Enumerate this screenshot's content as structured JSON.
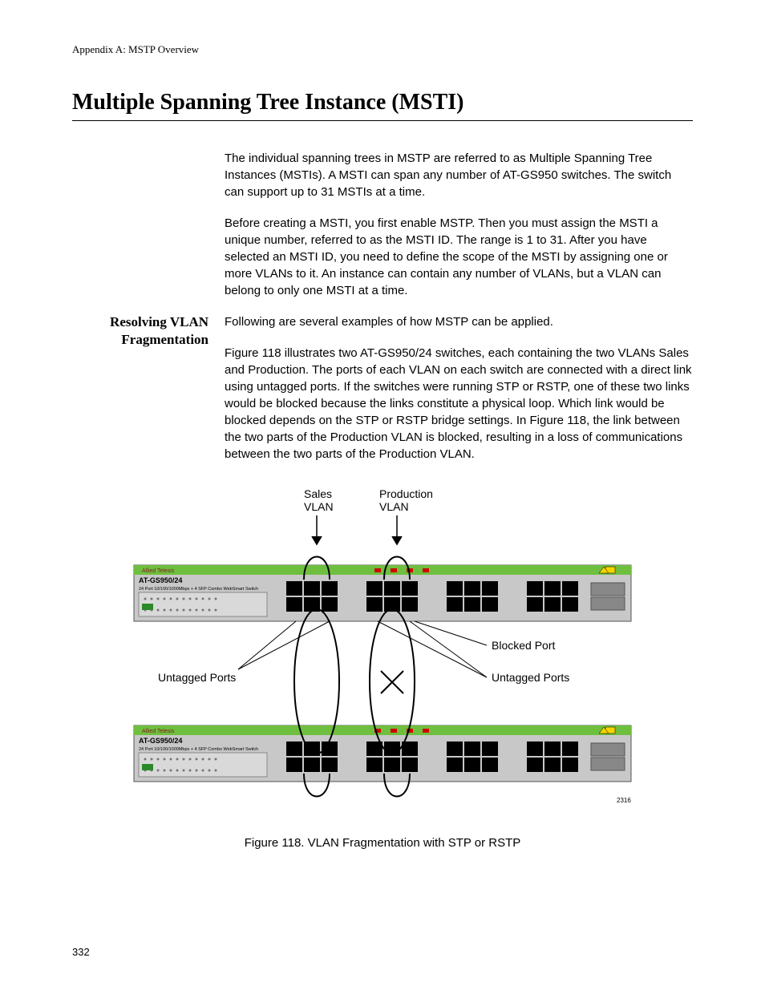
{
  "running_header": "Appendix A: MSTP Overview",
  "title": "Multiple Spanning Tree Instance (MSTI)",
  "intro": {
    "p1": "The individual spanning trees in MSTP are referred to as Multiple Spanning Tree Instances (MSTIs). A MSTI can span any number of AT-GS950 switches. The switch can support up to 31 MSTIs at a time.",
    "p2": "Before creating a MSTI, you first enable MSTP. Then you must assign the MSTI a unique number, referred to as the MSTI ID. The range is 1 to 31. After you have selected an MSTI ID, you need to define the scope of the MSTI by assigning one or more VLANs to it. An instance can contain any number of VLANs, but a VLAN can belong to only one MSTI at a time."
  },
  "section": {
    "heading": "Resolving VLAN Fragmentation",
    "p1": "Following are several examples of how MSTP can be applied.",
    "p2": "Figure 118 illustrates two AT-GS950/24 switches, each containing the two VLANs Sales and Production. The ports of each VLAN on each switch are connected with a direct link using untagged ports. If the switches were running STP or RSTP, one of these two links would be blocked because the links constitute a physical loop. Which link would be blocked depends on the STP or RSTP bridge settings. In Figure 118, the link between the two parts of the Production VLAN is blocked, resulting in a loss of communications between the two parts of the Production VLAN."
  },
  "figure": {
    "label_sales": "Sales VLAN",
    "label_production": "Production VLAN",
    "label_untagged_left": "Untagged Ports",
    "label_untagged_right": "Untagged Ports",
    "label_blocked": "Blocked Port",
    "switch_model": "AT-GS950/24",
    "switch_brand": "Allied Telesis",
    "switch_desc": "24 Port 10/100/1000Mbps + 4 SFP Combo WebSmart Switch",
    "figref": "2316",
    "caption": "Figure 118. VLAN Fragmentation with STP or RSTP"
  },
  "page_number": "332"
}
